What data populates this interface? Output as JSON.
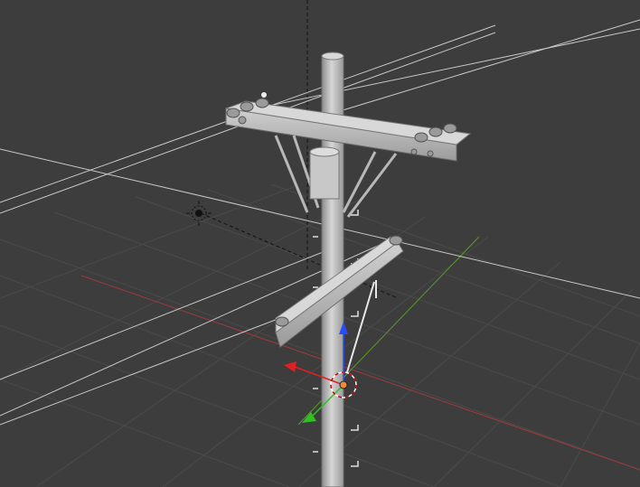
{
  "viewport": {
    "background": "#3d3d3d",
    "grid_color": "#4a4a4a",
    "x_axis_color": "#a23a3a",
    "y_axis_color": "#5a9a2a",
    "wire_color": "#c8c8c8",
    "pole_color": "#bdbdbd"
  },
  "icons": {
    "lamp": "sun-lamp-icon",
    "cursor": "3d-cursor-icon",
    "manipulator": "transform-manipulator-icon"
  }
}
